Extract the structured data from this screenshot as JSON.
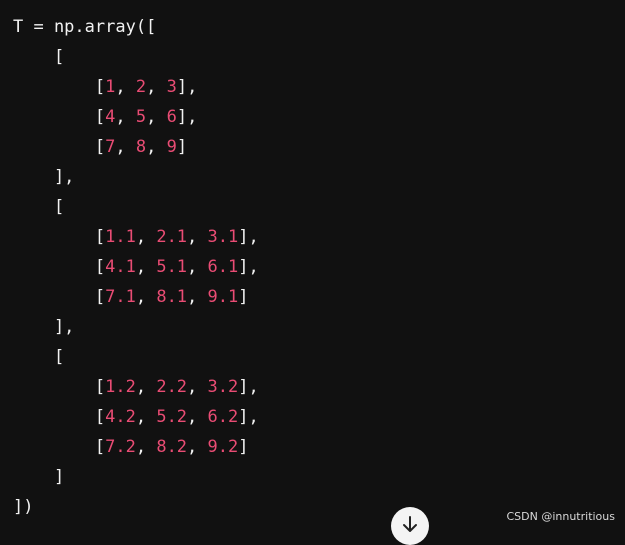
{
  "code": {
    "lines": [
      "T = np.array([",
      "    [",
      "        [1, 2, 3],",
      "        [4, 5, 6],",
      "        [7, 8, 9]",
      "    ],",
      "    [",
      "        [1.1, 2.1, 3.1],",
      "        [4.1, 5.1, 6.1],",
      "        [7.1, 8.1, 9.1]",
      "    ],",
      "    [",
      "        [1.2, 2.2, 3.2],",
      "        [4.2, 5.2, 6.2],",
      "        [7.2, 8.2, 9.2]",
      "    ]",
      "])"
    ]
  },
  "watermark": "CSDN @innutritious",
  "colors": {
    "background": "#111111",
    "text": "#f2f2f2",
    "number": "#e94c74"
  },
  "icons": {
    "scroll_down": "arrow-down-icon"
  }
}
